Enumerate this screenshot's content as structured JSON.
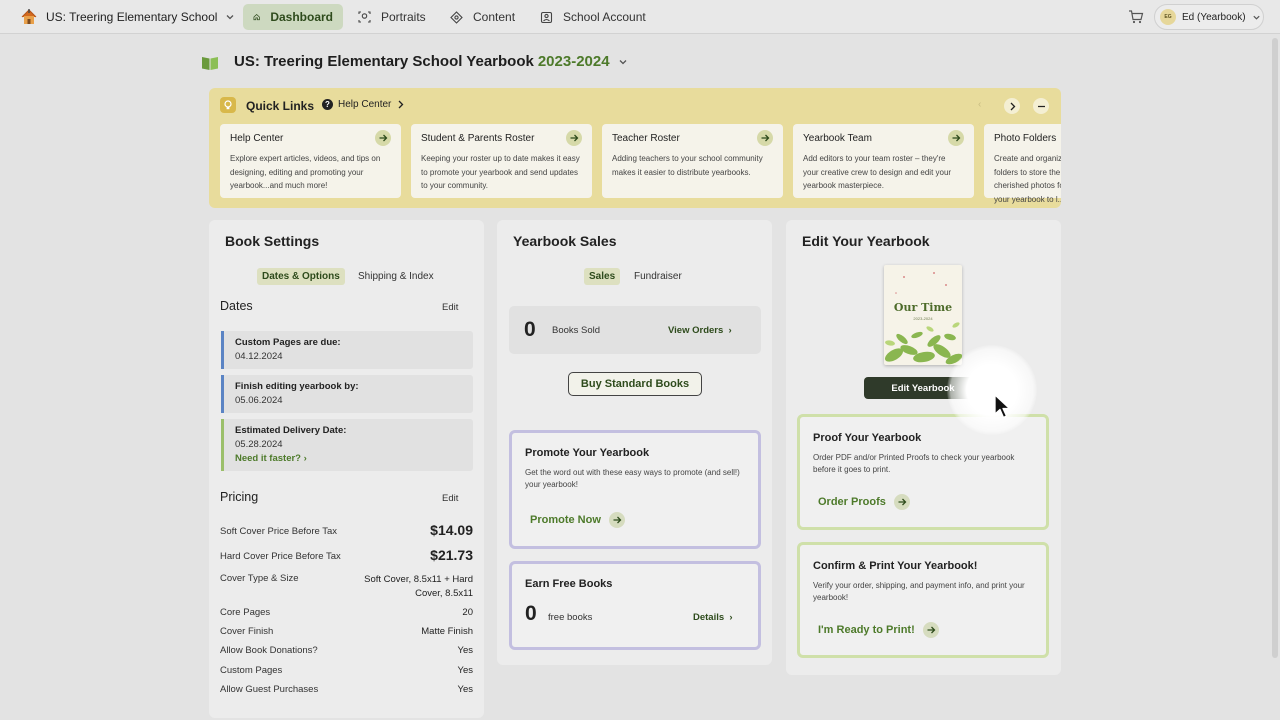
{
  "topbar": {
    "school_name": "US: Treering Elementary School",
    "nav": [
      {
        "label": "Dashboard",
        "active": true,
        "icon": "home-icon"
      },
      {
        "label": "Portraits",
        "active": false,
        "icon": "portrait-icon"
      },
      {
        "label": "Content",
        "active": false,
        "icon": "content-icon"
      },
      {
        "label": "School Account",
        "active": false,
        "icon": "account-icon"
      }
    ],
    "user_initials": "EG",
    "user_name": "Ed (Yearbook)"
  },
  "page": {
    "title": "US: Treering Elementary School Yearbook",
    "year": "2023-2024"
  },
  "quick_links": {
    "title": "Quick Links",
    "help_center_label": "Help Center",
    "cards": [
      {
        "title": "Help Center",
        "desc": "Explore expert articles, videos, and tips on designing, editing and promoting your yearbook...and much more!"
      },
      {
        "title": "Student & Parents Roster",
        "desc": "Keeping your roster up to date makes it easy to promote your yearbook and send updates to your community."
      },
      {
        "title": "Teacher Roster",
        "desc": "Adding teachers to your school community makes it easier to distribute yearbooks."
      },
      {
        "title": "Yearbook Team",
        "desc": "Add editors to your team roster – they're your creative crew to design and edit your yearbook masterpiece."
      },
      {
        "title": "Photo Folders",
        "desc": "Create and organize folders to store the cherished photos for your yearbook to l..."
      }
    ]
  },
  "book_settings": {
    "title": "Book Settings",
    "tabs": [
      "Dates & Options",
      "Shipping & Index"
    ],
    "dates_heading": "Dates",
    "edit_label": "Edit",
    "dates": [
      {
        "label": "Custom Pages are due:",
        "value": "04.12.2024",
        "color": "#5b84c4"
      },
      {
        "label": "Finish editing yearbook by:",
        "value": "05.06.2024",
        "color": "#5b84c4"
      },
      {
        "label": "Estimated Delivery Date:",
        "value": "05.28.2024",
        "extra": "Need it faster?",
        "color": "#9bbf6a"
      }
    ],
    "pricing_heading": "Pricing",
    "pricing": [
      {
        "label": "Soft Cover Price Before Tax",
        "value": "$14.09"
      },
      {
        "label": "Hard Cover Price Before Tax",
        "value": "$21.73"
      },
      {
        "label": "Cover Type & Size",
        "value_line1": "Soft Cover, 8.5x11 + Hard",
        "value_line2": "Cover, 8.5x11"
      },
      {
        "label": "Core Pages",
        "value": "20"
      },
      {
        "label": "Cover Finish",
        "value": "Matte Finish"
      },
      {
        "label": "Allow Book Donations?",
        "value": "Yes"
      },
      {
        "label": "Custom Pages",
        "value": "Yes"
      },
      {
        "label": "Allow Guest Purchases",
        "value": "Yes"
      }
    ]
  },
  "yearbook_sales": {
    "title": "Yearbook Sales",
    "tabs": [
      "Sales",
      "Fundraiser"
    ],
    "books_sold_count": "0",
    "books_sold_label": "Books Sold",
    "view_orders_label": "View Orders",
    "buy_button_label": "Buy Standard Books",
    "promote": {
      "title": "Promote Your Yearbook",
      "desc": "Get the word out with these easy ways to promote (and sell!) your yearbook!",
      "link_label": "Promote Now"
    },
    "earn": {
      "title": "Earn Free Books",
      "count": "0",
      "count_label": "free books",
      "details_label": "Details"
    }
  },
  "edit_yearbook": {
    "title": "Edit Your Yearbook",
    "cover_title": "Our Time",
    "cover_year": "2023-2024",
    "edit_button_label": "Edit Yearbook",
    "proof": {
      "title": "Proof Your Yearbook",
      "desc": "Order PDF and/or Printed Proofs to check your yearbook before it goes to print.",
      "link_label": "Order Proofs"
    },
    "print": {
      "title": "Confirm & Print Your Yearbook!",
      "desc": "Verify your order, shipping, and payment info, and print your yearbook!",
      "link_label": "I'm Ready to Print!"
    }
  },
  "colors": {
    "accent_green": "#4d7a2a",
    "quick_links_bg": "#e8dc9c",
    "purple_border": "#c3bfe0",
    "green_border": "#cfe0a9"
  }
}
